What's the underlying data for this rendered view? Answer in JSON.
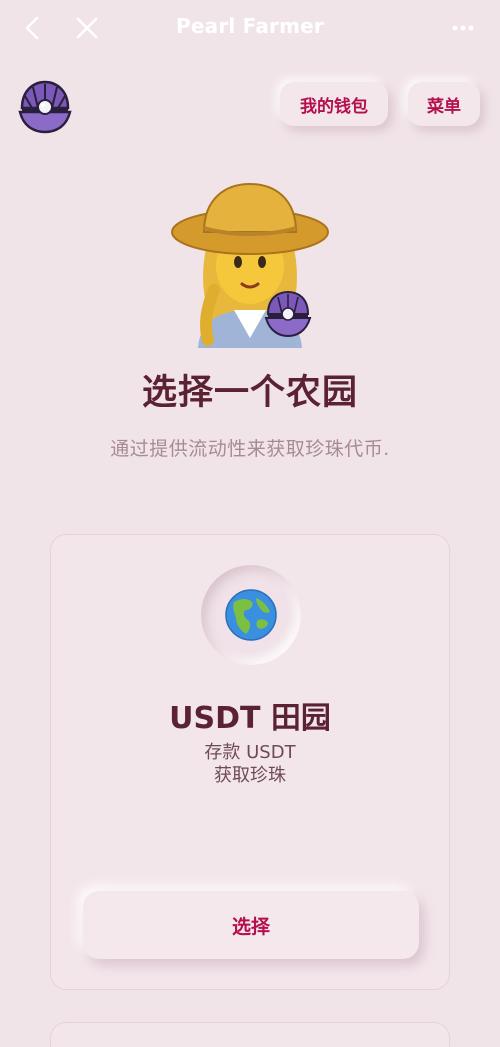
{
  "nav": {
    "title": "Pearl Farmer",
    "icons": {
      "back": "chevron-left-icon",
      "close": "close-icon",
      "more": "more-dots-icon"
    }
  },
  "header": {
    "logo": "pearl-oyster-logo",
    "wallet_label": "我的钱包",
    "menu_label": "菜单"
  },
  "hero": {
    "illustration": "farmer-woman-with-pearl-oyster",
    "title": "选择一个农园",
    "subtitle": "通过提供流动性来获取珍珠代币."
  },
  "farms": [
    {
      "icon": "globe-americas-icon",
      "name": "USDT 田园",
      "desc_line1": "存款 USDT",
      "desc_line2": "获取珍珠",
      "select_label": "选择"
    }
  ],
  "colors": {
    "background": "#f1e4e9",
    "accent": "#b5104e",
    "title": "#5b2233",
    "subtitle": "#a88a96"
  }
}
